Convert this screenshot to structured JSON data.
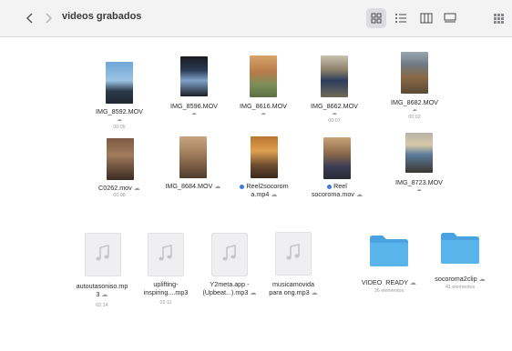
{
  "window": {
    "title": "videos grabados"
  },
  "videos_row1": [
    {
      "name": "IMG_8592.MOV",
      "duration": "00:05"
    },
    {
      "name": "IMG_8596.MOV",
      "duration": ""
    },
    {
      "name": "IMG_8616.MOV",
      "duration": ""
    },
    {
      "name": "IMG_8662.MOV",
      "duration": "00:07"
    },
    {
      "name": "IMG_8682.MOV",
      "duration": "00:02"
    }
  ],
  "videos_row2": [
    {
      "name": "C0262.mov",
      "duration": "00:08"
    },
    {
      "name": "IMG_8684.MOV",
      "duration": ""
    },
    {
      "name_line1": "Reel2socorom",
      "name_line2": "a.mp4"
    },
    {
      "name_line1": "Reel",
      "name_line2": "socoroma.mov"
    },
    {
      "name": "IMG_8723.MOV",
      "duration": ""
    }
  ],
  "audios": [
    {
      "line1": "autoutasoniso.mp",
      "line2": "3",
      "duration": "02:14"
    },
    {
      "line1": "uplifting-",
      "line2": "inspiring....mp3",
      "duration": "02:11"
    },
    {
      "line1": "Y2meta.app -",
      "line2": "(Upbeat...).mp3",
      "duration": ""
    },
    {
      "line1": "musicamovida",
      "line2": "para ong.mp3",
      "duration": ""
    }
  ],
  "folders": [
    {
      "name": "VIDEO  READY",
      "count": "26 elementos"
    },
    {
      "name": "socoroma2clip",
      "count": "41 elementos"
    }
  ],
  "colors": {
    "folder": "#5ab4ec",
    "tag_blue": "#3b7ce0",
    "background": "#b9b6e8"
  }
}
